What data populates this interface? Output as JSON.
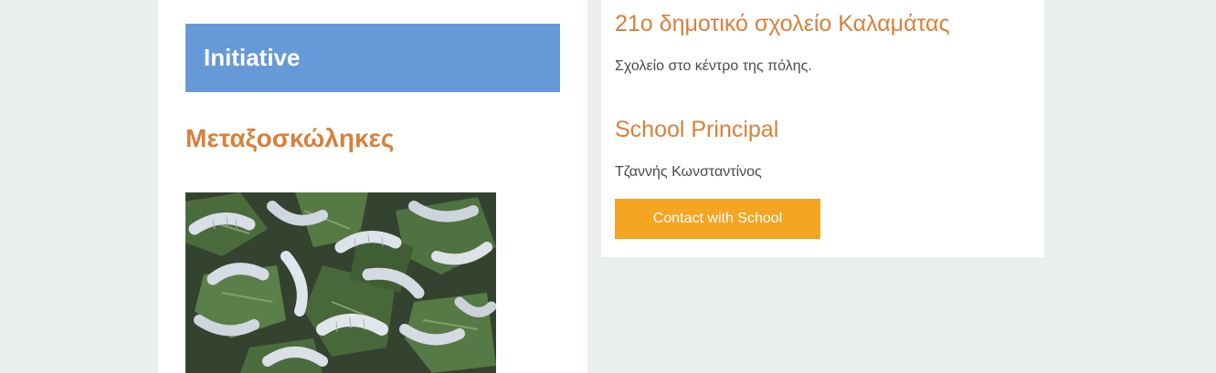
{
  "initiative": {
    "title": "Initiative"
  },
  "project": {
    "title": "Μεταξοσκώληκες",
    "image_icon": "silkworms-photo"
  },
  "school": {
    "name": "21ο δημοτικό σχολείο Καλαμάτας",
    "description": "Σχολείο στο κέντρο της πόλης.",
    "principal_heading": "School Principal",
    "principal_name": "Τζαννής Κωνσταντίνος",
    "contact_label": "Contact with School"
  },
  "colors": {
    "background": "#ebeff0",
    "banner": "#6699d8",
    "accent_orange": "#d9803a",
    "button": "#f4a521"
  }
}
